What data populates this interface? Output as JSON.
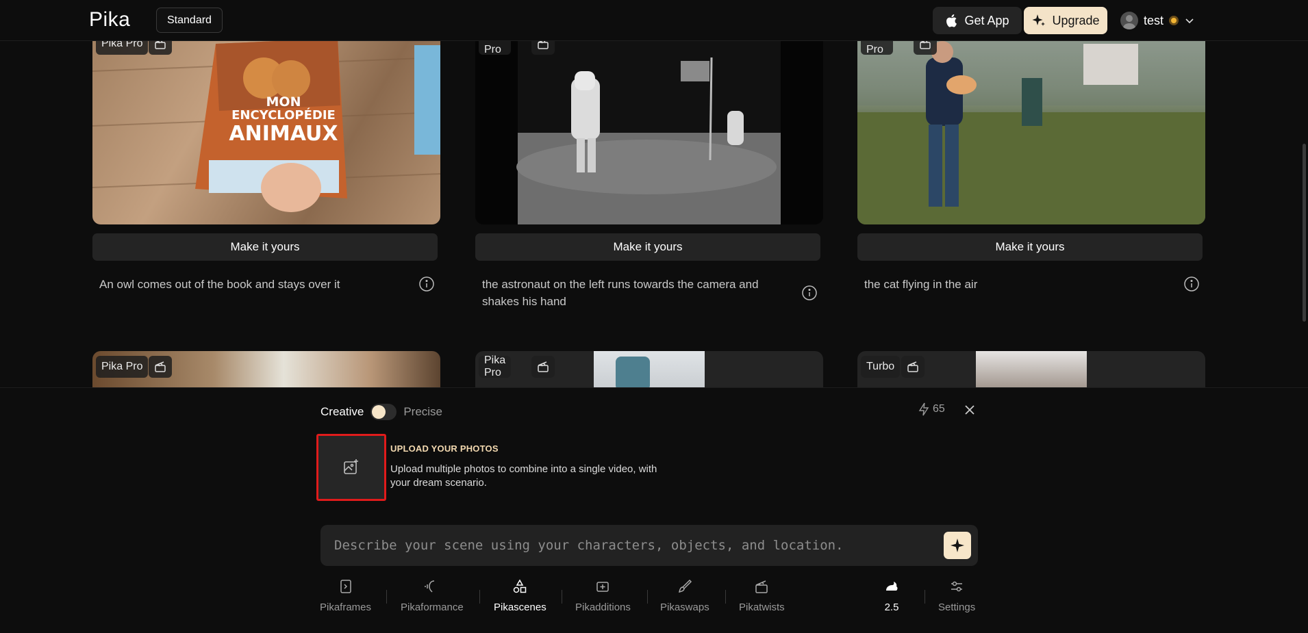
{
  "header": {
    "logo": "Pika",
    "plan": "Standard",
    "get_app": "Get App",
    "upgrade": "Upgrade",
    "username": "test"
  },
  "cards": [
    {
      "badge": "Pika Pro",
      "action": "Make it yours",
      "prompt": "An owl comes out of the book and stays over it",
      "book_line1": "MON",
      "book_line2": "ENCYCLOPÉDIE",
      "book_line3": "ANIMAUX"
    },
    {
      "badge": "Pika Pro",
      "action": "Make it yours",
      "prompt": "the astronaut on the left runs towards the camera and shakes his hand"
    },
    {
      "badge": "Pika Pro",
      "action": "Make it yours",
      "prompt": "the cat flying in the air"
    },
    {
      "badge": "Pika Pro"
    },
    {
      "badge": "Pika Pro"
    },
    {
      "badge": "Turbo"
    }
  ],
  "composer": {
    "mode_left": "Creative",
    "mode_right": "Precise",
    "credits": "65",
    "upload_title": "UPLOAD YOUR PHOTOS",
    "upload_desc": "Upload multiple photos to combine into a single video, with your dream scenario.",
    "placeholder": "Describe your scene using your characters, objects, and location."
  },
  "tools": [
    {
      "label": "Pikaframes"
    },
    {
      "label": "Pikaformance"
    },
    {
      "label": "Pikascenes"
    },
    {
      "label": "Pikadditions"
    },
    {
      "label": "Pikaswaps"
    },
    {
      "label": "Pikatwists"
    },
    {
      "label": "2.5"
    },
    {
      "label": "Settings"
    }
  ],
  "colors": {
    "accent": "#f4e3c8",
    "highlight_border": "#e01b1b",
    "background": "#0d0d0d"
  }
}
